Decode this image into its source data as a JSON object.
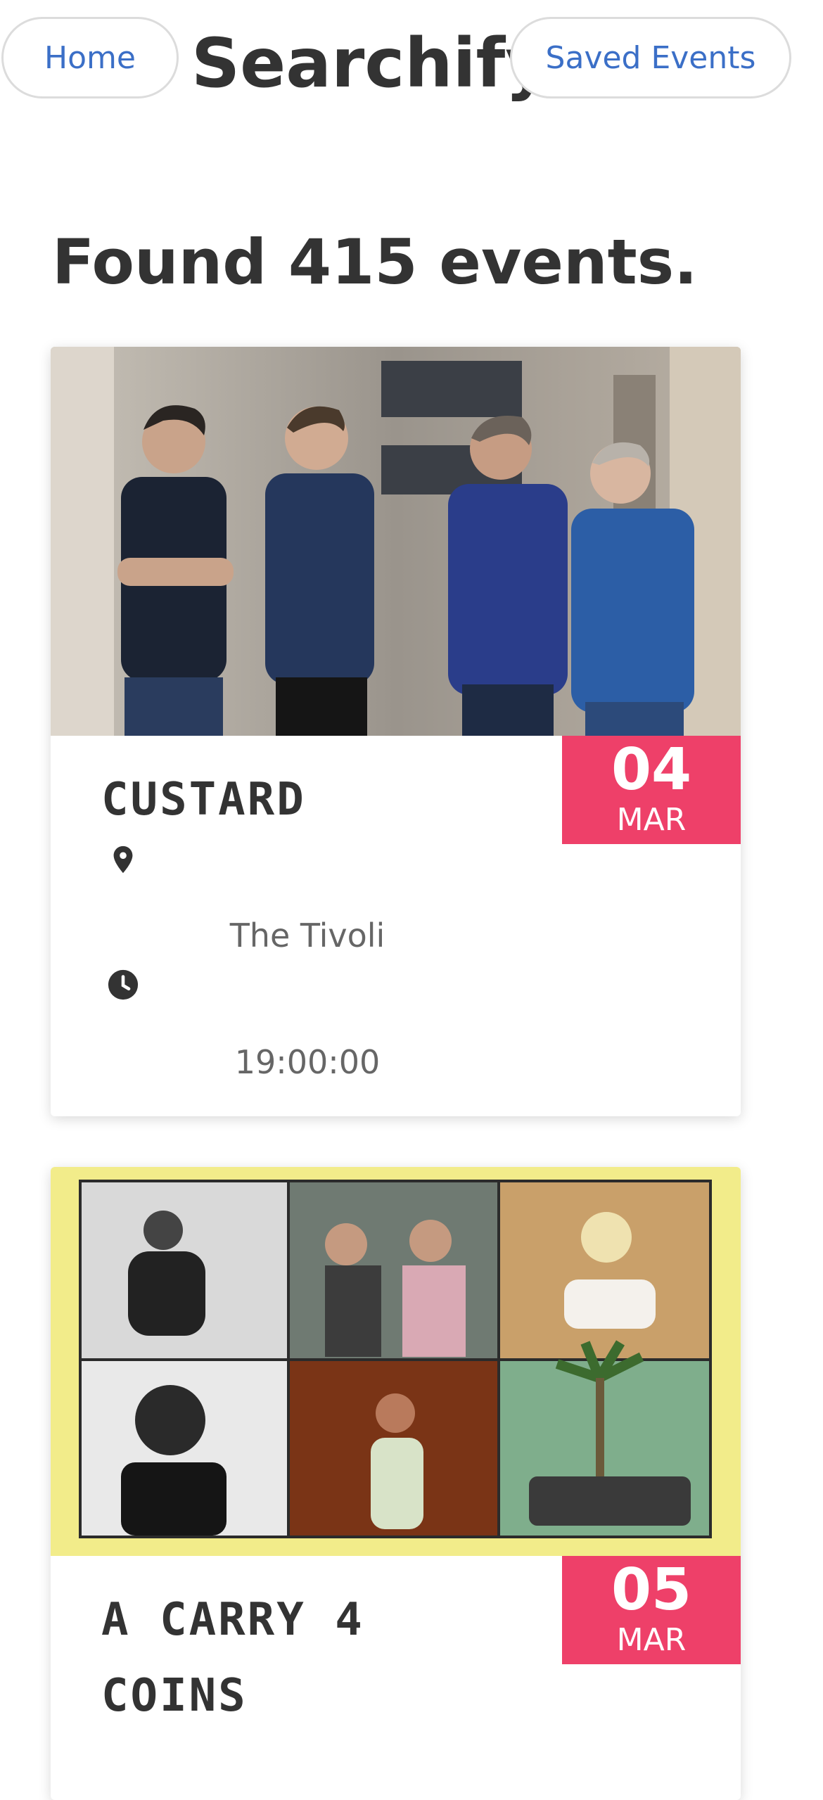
{
  "nav": {
    "home_label": "Home",
    "brand": "Searchify",
    "saved_label": "Saved Events"
  },
  "results": {
    "heading": "Found 415 events."
  },
  "events": [
    {
      "title": "CUSTARD",
      "day": "04",
      "month": "MAR",
      "venue": "The Tivoli",
      "time": "19:00:00",
      "image": "band-photo"
    },
    {
      "title": "A CARRY 4 COINS",
      "day": "05",
      "month": "MAR",
      "image": "artist-collage"
    }
  ],
  "colors": {
    "accent": "#ee4069",
    "link": "#3b6fc7",
    "text": "#333333",
    "muted": "#666666"
  },
  "icons": [
    "map-marker-icon",
    "clock-icon"
  ]
}
